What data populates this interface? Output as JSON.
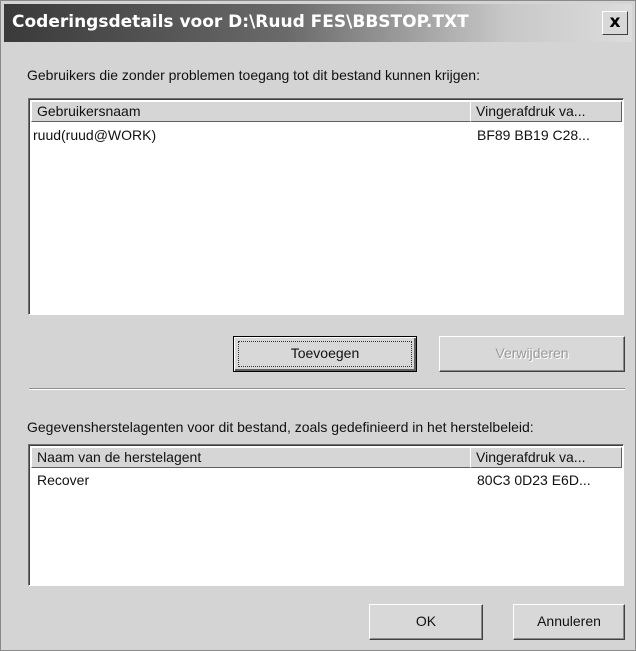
{
  "window": {
    "title": "Coderingsdetails voor D:\\Ruud FES\\BBSTOP.TXT",
    "close_label": "x"
  },
  "users_section": {
    "label": "Gebruikers die zonder problemen toegang tot dit bestand kunnen krijgen:",
    "columns": [
      "Gebruikersnaam",
      "Vingerafdruk va..."
    ],
    "rows": [
      [
        "ruud(ruud@WORK)",
        "BF89 BB19 C28..."
      ]
    ],
    "add_button": "Toevoegen",
    "remove_button": "Verwijderen"
  },
  "recovery_section": {
    "label": "Gegevensherstelagenten voor dit bestand, zoals gedefinieerd in het herstelbeleid:",
    "columns": [
      "Naam van de herstelagent",
      "Vingerafdruk va..."
    ],
    "rows": [
      [
        "Recover",
        "80C3 0D23 E6D..."
      ]
    ]
  },
  "footer": {
    "ok_button": "OK",
    "cancel_button": "Annuleren"
  }
}
